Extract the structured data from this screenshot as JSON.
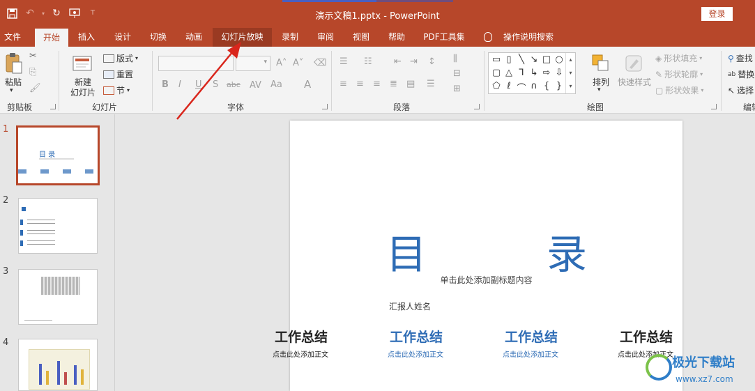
{
  "app": {
    "doc_title": "演示文稿1.pptx  -  PowerPoint",
    "login_label": "登录",
    "accent_color": "#b7472a"
  },
  "qat": {
    "save_icon": "save-icon",
    "undo_icon": "undo-icon",
    "redo_icon": "redo-icon",
    "present_icon": "present-from-start-icon",
    "customize_icon": "customize-qat-icon"
  },
  "tabs": [
    {
      "label": "文件"
    },
    {
      "label": "开始"
    },
    {
      "label": "插入"
    },
    {
      "label": "设计"
    },
    {
      "label": "切换"
    },
    {
      "label": "动画"
    },
    {
      "label": "幻灯片放映"
    },
    {
      "label": "录制"
    },
    {
      "label": "审阅"
    },
    {
      "label": "视图"
    },
    {
      "label": "帮助"
    },
    {
      "label": "PDF工具集"
    },
    {
      "label": "操作说明搜索"
    }
  ],
  "ribbon": {
    "clipboard": {
      "paste": "粘贴",
      "group": "剪贴板"
    },
    "slides": {
      "new_slide": "新建",
      "new_slide2": "幻灯片",
      "layout": "版式",
      "reset": "重置",
      "section": "节",
      "group": "幻灯片"
    },
    "font": {
      "group": "字体",
      "bold": "B",
      "italic": "I",
      "underline": "U",
      "shadow": "S",
      "strike": "abc",
      "case": "Aa",
      "color": "A"
    },
    "paragraph": {
      "group": "段落"
    },
    "drawing": {
      "group": "绘图",
      "arrange": "排列",
      "quick_styles": "快速样式",
      "fill": "形状填充",
      "outline": "形状轮廓",
      "effects": "形状效果"
    },
    "editing": {
      "find": "查找",
      "replace": "替换",
      "select": "选择",
      "group": "编辑"
    }
  },
  "thumbnails": [
    {
      "num": "1",
      "title": "目  录"
    },
    {
      "num": "2"
    },
    {
      "num": "3"
    },
    {
      "num": "4"
    }
  ],
  "slide": {
    "title_left": "目",
    "title_right": "录",
    "subtitle": "单击此处添加副标题内容",
    "reporter": "汇报人姓名",
    "cards": [
      {
        "title": "工作总结",
        "text": "点击此处添加正文",
        "color": "#222222"
      },
      {
        "title": "工作总结",
        "text": "点击此处添加正文",
        "color": "#2e6cb5"
      },
      {
        "title": "工作总结",
        "text": "点击此处添加正文",
        "color": "#2e6cb5"
      },
      {
        "title": "工作总结",
        "text": "点击此处添加正文",
        "color": "#222222"
      }
    ]
  },
  "watermark": {
    "text1": "极光下载站",
    "text2": "www.xz7.com"
  }
}
